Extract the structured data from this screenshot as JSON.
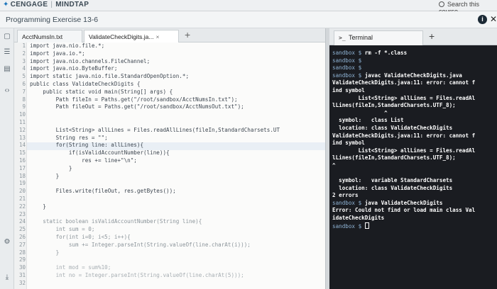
{
  "brand": {
    "logo": "✦",
    "name": "CENGAGE",
    "product": "MINDTAP"
  },
  "search": {
    "label": "Search this course"
  },
  "exercise": {
    "title": "Programming Exercise 13-6",
    "info_label": "i",
    "close_label": "✕"
  },
  "editor": {
    "tabs": [
      {
        "label": "AcctNumsIn.txt"
      },
      {
        "label": "ValidateCheckDigits.ja...",
        "close": "×"
      }
    ],
    "add_tab": "+",
    "line_numbers": [
      "1",
      "2",
      "3",
      "4",
      "5",
      "6",
      "7",
      "8",
      "9",
      "10",
      "11",
      "12",
      "13",
      "14",
      "15",
      "16",
      "17",
      "18",
      "19",
      "20",
      "21",
      "22",
      "23",
      "24",
      "25",
      "26",
      "27",
      "28",
      "29",
      "30",
      "31",
      "32"
    ],
    "lines": [
      "import java.nio.file.*;",
      "import java.io.*;",
      "import java.nio.channels.FileChannel;",
      "import java.nio.ByteBuffer;",
      "import static java.nio.file.StandardOpenOption.*;",
      "public class ValidateCheckDigits {",
      "    public static void main(String[] args) {",
      "        Path fileIn = Paths.get(\"/root/sandbox/AcctNumsIn.txt\");",
      "        Path fileOut = Paths.get(\"/root/sandbox/AcctNumsOut.txt\");",
      "",
      "",
      "        List<String> allLines = Files.readAllLines(fileIn,StandardCharsets.UT",
      "        String res = \"\";",
      "        for(String line: allLines){",
      "            if(isValidAccountNumber(line)){",
      "                res += line+\"\\n\";",
      "            }",
      "        }",
      "",
      "        Files.write(fileOut, res.getBytes());",
      "",
      "    }",
      "",
      "    static boolean isValidAccountNumber(String line){",
      "        int sum = 0;",
      "        for(int i=0; i<5; i++){",
      "            sum += Integer.parseInt(String.valueOf(line.charAt(i)));",
      "        }",
      "",
      "        int mod = sum%10;",
      "        int no = Integer.parseInt(String.valueOf(line.charAt(5)));"
    ]
  },
  "terminal": {
    "tab_prompt": ">_",
    "tab_label": "Terminal",
    "add_tab": "+",
    "lines": [
      {
        "p": "sandbox $ ",
        "t": "rm -f *.class"
      },
      {
        "p": "sandbox $",
        "t": ""
      },
      {
        "p": "sandbox $",
        "t": ""
      },
      {
        "p": "sandbox $ ",
        "t": "javac ValidateCheckDigits.java"
      },
      {
        "p": "",
        "t": "ValidateCheckDigits.java:11: error: cannot f"
      },
      {
        "p": "",
        "t": "ind symbol"
      },
      {
        "p": "",
        "t": "        List<String> allLines = Files.readAl"
      },
      {
        "p": "",
        "t": "lLines(fileIn,StandardCharsets.UTF_8);"
      },
      {
        "p": "",
        "t": "                ^"
      },
      {
        "p": "",
        "t": "  symbol:   class List"
      },
      {
        "p": "",
        "t": "  location: class ValidateCheckDigits"
      },
      {
        "p": "",
        "t": "ValidateCheckDigits.java:11: error: cannot f"
      },
      {
        "p": "",
        "t": "ind symbol"
      },
      {
        "p": "",
        "t": "        List<String> allLines = Files.readAl"
      },
      {
        "p": "",
        "t": "lLines(fileIn,StandardCharsets.UTF_8);"
      },
      {
        "p": "",
        "t": "^"
      },
      {
        "p": "",
        "t": ""
      },
      {
        "p": "",
        "t": "  symbol:   variable StandardCharsets"
      },
      {
        "p": "",
        "t": "  location: class ValidateCheckDigits"
      },
      {
        "p": "",
        "t": "2 errors"
      },
      {
        "p": "sandbox $ ",
        "t": "java ValidateCheckDigits"
      },
      {
        "p": "",
        "t": "Error: Could not find or load main class Val"
      },
      {
        "p": "",
        "t": "idateCheckDigits"
      },
      {
        "p": "sandbox $ ",
        "t": "",
        "cursor": true
      }
    ]
  }
}
